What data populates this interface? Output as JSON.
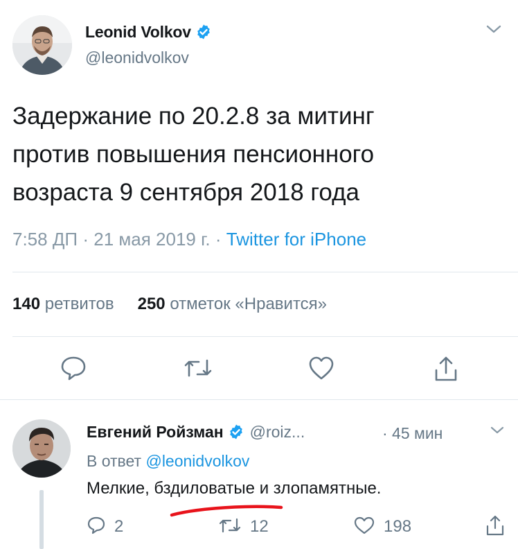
{
  "tweet": {
    "author_name": "Leonid Volkov",
    "author_handle": "@leonidvolkov",
    "text": "Задержание по 20.2.8 за митинг\nпротив повышения пенсионного\nвозраста 9 сентября 2018 года",
    "time": "7:58 ДП",
    "date": "21 мая 2019 г.",
    "separator": "·",
    "source": "Twitter for iPhone",
    "retweets_count": "140",
    "retweets_label": "ретвитов",
    "likes_count": "250",
    "likes_label": "отметок «Нравится»"
  },
  "reply": {
    "author_name": "Евгений Ройзман",
    "author_handle": "@roiz...",
    "time": "· 45 мин",
    "reply_prefix": "В ответ",
    "reply_mention": "@leonidvolkov",
    "text": "Мелкие, бздиловатые и злопамятные.",
    "replies_count": "2",
    "retweets_count": "12",
    "likes_count": "198"
  },
  "colors": {
    "verified": "#1da1f2",
    "link": "#1b95e0",
    "muted": "#657786",
    "annotation": "#e8131b"
  }
}
